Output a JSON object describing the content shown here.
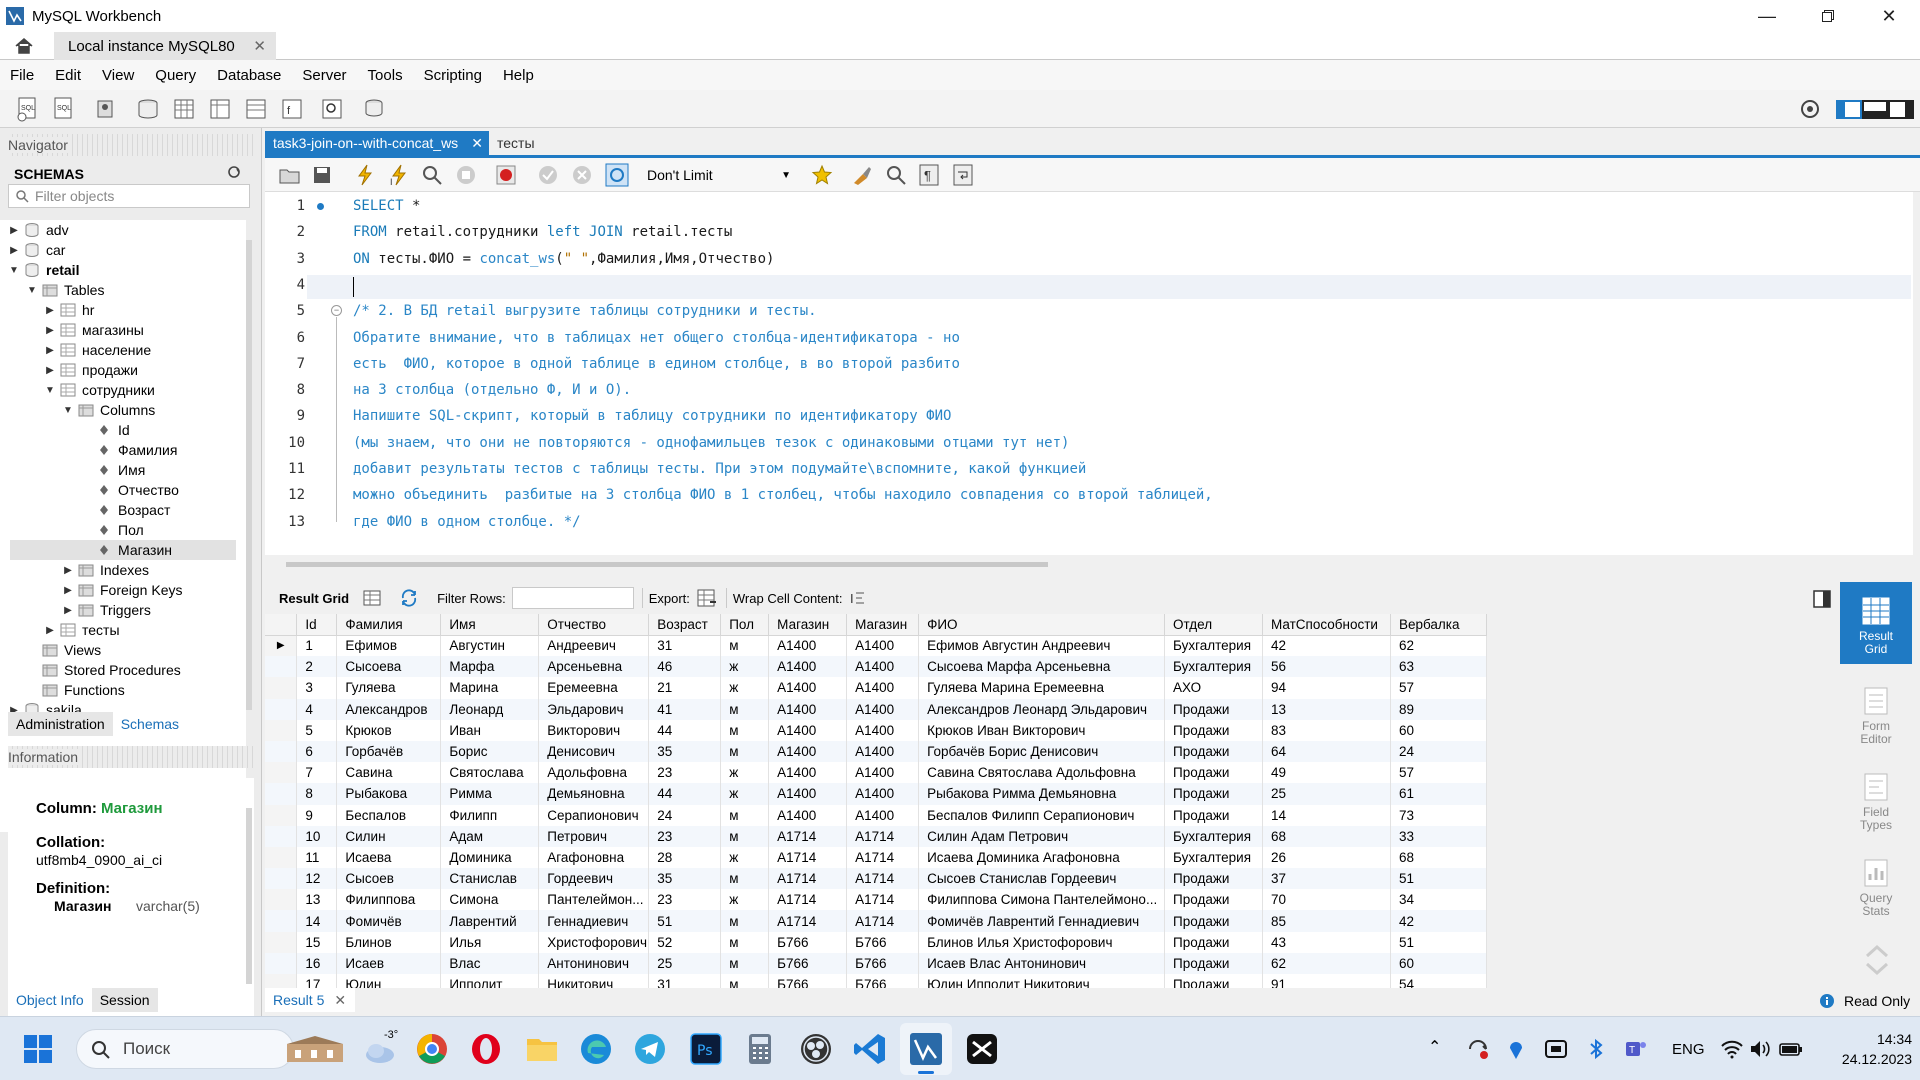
{
  "window": {
    "title": "MySQL Workbench"
  },
  "connection_tab": "Local instance MySQL80",
  "menu": [
    "File",
    "Edit",
    "View",
    "Query",
    "Database",
    "Server",
    "Tools",
    "Scripting",
    "Help"
  ],
  "navigator": {
    "header": "Navigator",
    "schemas_label": "SCHEMAS",
    "filter_placeholder": "Filter objects",
    "tree": [
      {
        "label": "adv",
        "level": 0,
        "type": "schema",
        "tw": "▶"
      },
      {
        "label": "car",
        "level": 0,
        "type": "schema",
        "tw": "▶"
      },
      {
        "label": "retail",
        "level": 0,
        "type": "schema",
        "tw": "▼",
        "bold": true
      },
      {
        "label": "Tables",
        "level": 1,
        "type": "folder",
        "tw": "▼"
      },
      {
        "label": "hr",
        "level": 2,
        "type": "table",
        "tw": "▶"
      },
      {
        "label": "магазины",
        "level": 2,
        "type": "table",
        "tw": "▶"
      },
      {
        "label": "население",
        "level": 2,
        "type": "table",
        "tw": "▶"
      },
      {
        "label": "продажи",
        "level": 2,
        "type": "table",
        "tw": "▶"
      },
      {
        "label": "сотрудники",
        "level": 2,
        "type": "table",
        "tw": "▼"
      },
      {
        "label": "Columns",
        "level": 3,
        "type": "folder",
        "tw": "▼"
      },
      {
        "label": "Id",
        "level": 4,
        "type": "column",
        "tw": ""
      },
      {
        "label": "Фамилия",
        "level": 4,
        "type": "column",
        "tw": ""
      },
      {
        "label": "Имя",
        "level": 4,
        "type": "column",
        "tw": ""
      },
      {
        "label": "Отчество",
        "level": 4,
        "type": "column",
        "tw": ""
      },
      {
        "label": "Возраст",
        "level": 4,
        "type": "column",
        "tw": ""
      },
      {
        "label": "Пол",
        "level": 4,
        "type": "column",
        "tw": ""
      },
      {
        "label": "Магазин",
        "level": 4,
        "type": "column",
        "tw": "",
        "selected": true
      },
      {
        "label": "Indexes",
        "level": 3,
        "type": "folder",
        "tw": "▶"
      },
      {
        "label": "Foreign Keys",
        "level": 3,
        "type": "folder",
        "tw": "▶"
      },
      {
        "label": "Triggers",
        "level": 3,
        "type": "folder",
        "tw": "▶"
      },
      {
        "label": "тесты",
        "level": 2,
        "type": "table",
        "tw": "▶"
      },
      {
        "label": "Views",
        "level": 1,
        "type": "folder",
        "tw": ""
      },
      {
        "label": "Stored Procedures",
        "level": 1,
        "type": "folder",
        "tw": ""
      },
      {
        "label": "Functions",
        "level": 1,
        "type": "folder",
        "tw": ""
      },
      {
        "label": "sakila",
        "level": 0,
        "type": "schema",
        "tw": "▶"
      }
    ],
    "tabs": [
      "Administration",
      "Schemas"
    ]
  },
  "information": {
    "header": "Information",
    "column_label": "Column:",
    "column_value": "Магазин",
    "collation_label": "Collation:",
    "collation_value": "utf8mb4_0900_ai_ci",
    "definition_label": "Definition:",
    "definition_name": "Магазин",
    "definition_type": "varchar(5)",
    "tabs": [
      "Object Info",
      "Session"
    ]
  },
  "editor": {
    "tabs": [
      "task3-join-on--with-concat_ws",
      "тесты"
    ],
    "limit": "Don't Limit",
    "lines": [
      {
        "n": "1",
        "html": "<span class='kw'>SELECT</span> *"
      },
      {
        "n": "2",
        "html": "<span class='kw'>FROM</span> retail.сотрудники <span class='kw'>left JOIN</span> retail.тесты"
      },
      {
        "n": "3",
        "html": "<span class='kw'>ON</span> тесты.ФИО = <span class='fn'>concat_ws</span>(<span class='str'>\" \"</span>,Фамилия,Имя,Отчество)"
      },
      {
        "n": "4",
        "html": ""
      },
      {
        "n": "5",
        "html": "<span class='cm'>/* 2. В БД retail выгрузите таблицы сотрудники и тесты.</span>"
      },
      {
        "n": "6",
        "html": "<span class='cm'>Обратите внимание, что в таблицах нет общего столбца-идентификатора - но</span>"
      },
      {
        "n": "7",
        "html": "<span class='cm'>есть  ФИО, которое в одной таблице в едином столбце, в во второй разбито</span>"
      },
      {
        "n": "8",
        "html": "<span class='cm'>на 3 столбца (отдельно Ф, И и О).</span>"
      },
      {
        "n": "9",
        "html": "<span class='cm'>Напишите SQL-скрипт, который в таблицу сотрудники по идентификатору ФИО</span>"
      },
      {
        "n": "10",
        "html": "<span class='cm'>(мы знаем, что они не повторяются - однофамильцев тезок с одинаковыми отцами тут нет)</span>"
      },
      {
        "n": "11",
        "html": "<span class='cm'>добавит результаты тестов с таблицы тесты. При этом подумайте\\вспомните, какой функцией</span>"
      },
      {
        "n": "12",
        "html": "<span class='cm'>можно объединить  разбитые на 3 столбца ФИО в 1 столбец, чтобы находило совпадения со второй таблицей,</span>"
      },
      {
        "n": "13",
        "html": "<span class='cm'>где ФИО в одном столбце. */</span>"
      }
    ]
  },
  "result": {
    "toolbar": {
      "grid_label": "Result Grid",
      "filter_label": "Filter Rows:",
      "export_label": "Export:",
      "wrap_label": "Wrap Cell Content:"
    },
    "columns": [
      "Id",
      "Фамилия",
      "Имя",
      "Отчество",
      "Возраст",
      "Пол",
      "Магазин",
      "Магазин",
      "ФИО",
      "Отдел",
      "МатСпособности",
      "Вербалка"
    ],
    "rows": [
      [
        "1",
        "Ефимов",
        "Августин",
        "Андреевич",
        "31",
        "м",
        "A1400",
        "A1400",
        "Ефимов Августин Андреевич",
        "Бухгалтерия",
        "42",
        "62"
      ],
      [
        "2",
        "Сысоева",
        "Марфа",
        "Арсеньевна",
        "46",
        "ж",
        "A1400",
        "A1400",
        "Сысоева Марфа Арсеньевна",
        "Бухгалтерия",
        "56",
        "63"
      ],
      [
        "3",
        "Гуляева",
        "Марина",
        "Еремеевна",
        "21",
        "ж",
        "A1400",
        "A1400",
        "Гуляева Марина Еремеевна",
        "АХО",
        "94",
        "57"
      ],
      [
        "4",
        "Александров",
        "Леонард",
        "Эльдарович",
        "41",
        "м",
        "A1400",
        "A1400",
        "Александров Леонард Эльдарович",
        "Продажи",
        "13",
        "89"
      ],
      [
        "5",
        "Крюков",
        "Иван",
        "Викторович",
        "44",
        "м",
        "A1400",
        "A1400",
        "Крюков Иван Викторович",
        "Продажи",
        "83",
        "60"
      ],
      [
        "6",
        "Горбачёв",
        "Борис",
        "Денисович",
        "35",
        "м",
        "A1400",
        "A1400",
        "Горбачёв Борис Денисович",
        "Продажи",
        "64",
        "24"
      ],
      [
        "7",
        "Савина",
        "Святослава",
        "Адольфовна",
        "23",
        "ж",
        "A1400",
        "A1400",
        "Савина Святослава Адольфовна",
        "Продажи",
        "49",
        "57"
      ],
      [
        "8",
        "Рыбакова",
        "Римма",
        "Демьяновна",
        "44",
        "ж",
        "A1400",
        "A1400",
        "Рыбакова Римма Демьяновна",
        "Продажи",
        "25",
        "61"
      ],
      [
        "9",
        "Беспалов",
        "Филипп",
        "Серапионович",
        "24",
        "м",
        "A1400",
        "A1400",
        "Беспалов Филипп Серапионович",
        "Продажи",
        "14",
        "73"
      ],
      [
        "10",
        "Силин",
        "Адам",
        "Петрович",
        "23",
        "м",
        "A1714",
        "A1714",
        "Силин Адам Петрович",
        "Бухгалтерия",
        "68",
        "33"
      ],
      [
        "11",
        "Исаева",
        "Доминика",
        "Агафоновна",
        "28",
        "ж",
        "A1714",
        "A1714",
        "Исаева Доминика Агафоновна",
        "Бухгалтерия",
        "26",
        "68"
      ],
      [
        "12",
        "Сысоев",
        "Станислав",
        "Гордеевич",
        "35",
        "м",
        "A1714",
        "A1714",
        "Сысоев Станислав Гордеевич",
        "Продажи",
        "37",
        "51"
      ],
      [
        "13",
        "Филиппова",
        "Симона",
        "Пантелеймон...",
        "23",
        "ж",
        "A1714",
        "A1714",
        "Филиппова Симона Пантелеймоно...",
        "Продажи",
        "70",
        "34"
      ],
      [
        "14",
        "Фомичёв",
        "Лаврентий",
        "Геннадиевич",
        "51",
        "м",
        "A1714",
        "A1714",
        "Фомичёв Лаврентий Геннадиевич",
        "Продажи",
        "85",
        "42"
      ],
      [
        "15",
        "Блинов",
        "Илья",
        "Христофорович",
        "52",
        "м",
        "Б766",
        "Б766",
        "Блинов Илья Христофорович",
        "Продажи",
        "43",
        "51"
      ],
      [
        "16",
        "Исаев",
        "Влас",
        "Антонинович",
        "25",
        "м",
        "Б766",
        "Б766",
        "Исаев Влас Антонинович",
        "Продажи",
        "62",
        "60"
      ],
      [
        "17",
        "Юдин",
        "Ипполит",
        "Никитович",
        "31",
        "м",
        "Б766",
        "Б766",
        "Юдин Ипполит Никитович",
        "Продажи",
        "91",
        "54"
      ]
    ],
    "side_buttons": [
      "Result\nGrid",
      "Form\nEditor",
      "Field\nTypes",
      "Query\nStats"
    ],
    "tab": "Result 5",
    "read_only": "Read Only"
  },
  "taskbar": {
    "search_placeholder": "Поиск",
    "weather_temp": "-3°",
    "lang": "ENG",
    "time": "14:34",
    "date": "24.12.2023"
  }
}
